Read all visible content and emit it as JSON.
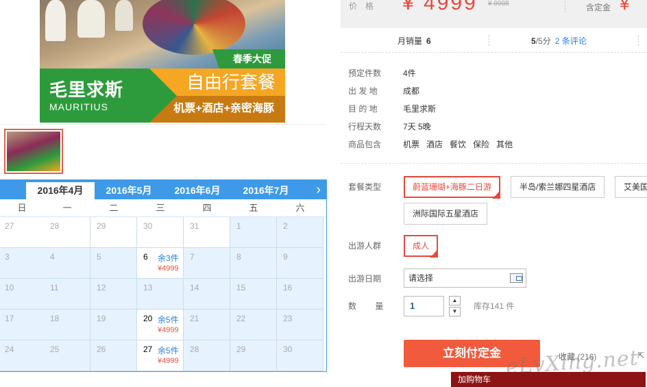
{
  "banner": {
    "promo": "春季大促",
    "destination_cn": "毛里求斯",
    "destination_en": "MAURITIUS",
    "package": "自由行套餐",
    "includes": "机票+酒店+亲密海豚"
  },
  "calendar": {
    "tabs": [
      "2016年4月",
      "2016年5月",
      "2016年6月",
      "2016年7月"
    ],
    "active_tab": "2016年4月",
    "next_label": "›",
    "weekdays": [
      "日",
      "一",
      "二",
      "三",
      "四",
      "五",
      "六"
    ],
    "weeks": [
      [
        {
          "d": "27"
        },
        {
          "d": "28"
        },
        {
          "d": "29"
        },
        {
          "d": "30"
        },
        {
          "d": "31"
        },
        {
          "d": "1"
        },
        {
          "d": "2"
        }
      ],
      [
        {
          "d": "3"
        },
        {
          "d": "4"
        },
        {
          "d": "5"
        },
        {
          "d": "6",
          "left": "余3件",
          "price": "¥4999"
        },
        {
          "d": "7"
        },
        {
          "d": "8"
        },
        {
          "d": "9"
        }
      ],
      [
        {
          "d": "10"
        },
        {
          "d": "11"
        },
        {
          "d": "12"
        },
        {
          "d": "13"
        },
        {
          "d": "14"
        },
        {
          "d": "15"
        },
        {
          "d": "16"
        }
      ],
      [
        {
          "d": "17"
        },
        {
          "d": "18"
        },
        {
          "d": "19"
        },
        {
          "d": "20",
          "left": "余5件",
          "price": "¥4999"
        },
        {
          "d": "21"
        },
        {
          "d": "22"
        },
        {
          "d": "23"
        }
      ],
      [
        {
          "d": "24"
        },
        {
          "d": "25"
        },
        {
          "d": "26"
        },
        {
          "d": "27",
          "left": "余5件",
          "price": "¥4999"
        },
        {
          "d": "28"
        },
        {
          "d": "29"
        },
        {
          "d": "30"
        }
      ]
    ],
    "white_cells_first_row": 5
  },
  "price": {
    "label": "价格",
    "value": "¥ 4999",
    "original": "¥ 9998",
    "deposit_label": "含定金",
    "deposit_value": "¥"
  },
  "sales": {
    "monthly_label": "月销量",
    "monthly_value": "6",
    "rating_value": "5",
    "rating_suffix": "/5分",
    "reviews": "2 条评论"
  },
  "details": [
    {
      "k": "预定件数",
      "v": "4件"
    },
    {
      "k": "出 发 地",
      "v": "成都"
    },
    {
      "k": "目 的 地",
      "v": "毛里求斯"
    },
    {
      "k": "行程天数",
      "v": "7天 5晚"
    }
  ],
  "includes": {
    "label": "商品包含",
    "items": [
      "机票",
      "酒店",
      "餐饮",
      "保险",
      "其他"
    ]
  },
  "package_type": {
    "label": "套餐类型",
    "options": [
      "蔚蓝珊瑚+海豚二日游",
      "半岛/索兰娜四星酒店",
      "艾美国",
      "洲际国际五星酒店"
    ]
  },
  "travelers": {
    "label": "出游人群",
    "option": "成人"
  },
  "date": {
    "label": "出游日期",
    "placeholder": "请选择"
  },
  "quantity": {
    "label": "数 量",
    "value": "1",
    "up": "▲",
    "down": "▼",
    "stock": "库存141 件"
  },
  "actions": {
    "buy": "立刻付定金",
    "fav_label": "收藏",
    "fav_count": "(216)",
    "share": "⇱",
    "cart": "加购物车"
  },
  "watermark": "eLvXing.net",
  "colors": {
    "accent": "#e8473a",
    "calendar_blue": "#3e9ae8",
    "link": "#2b7fd8"
  }
}
